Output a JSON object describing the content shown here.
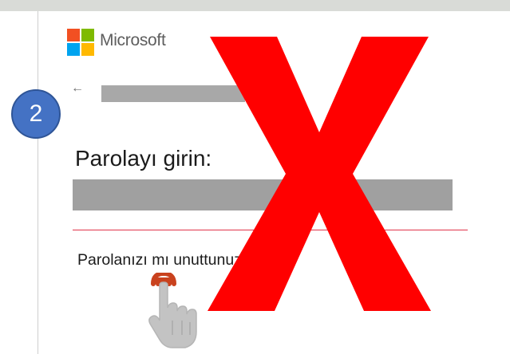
{
  "brand": {
    "name": "Microsoft"
  },
  "step_badge": {
    "number": "2"
  },
  "signin": {
    "back_glyph": "←",
    "heading": "Parolayı girin:",
    "forgot_link": "Parolanızı mı unuttunuz?"
  },
  "overlay": {
    "cross_glyph": "X",
    "cross_color": "#ff0000",
    "cursor_icon": "hand-pointer-icon",
    "click_marker_color": "#c9421e"
  },
  "colors": {
    "badge_fill": "#4472c4",
    "error_line": "#e0344a",
    "redaction": "#a8a8a8"
  }
}
